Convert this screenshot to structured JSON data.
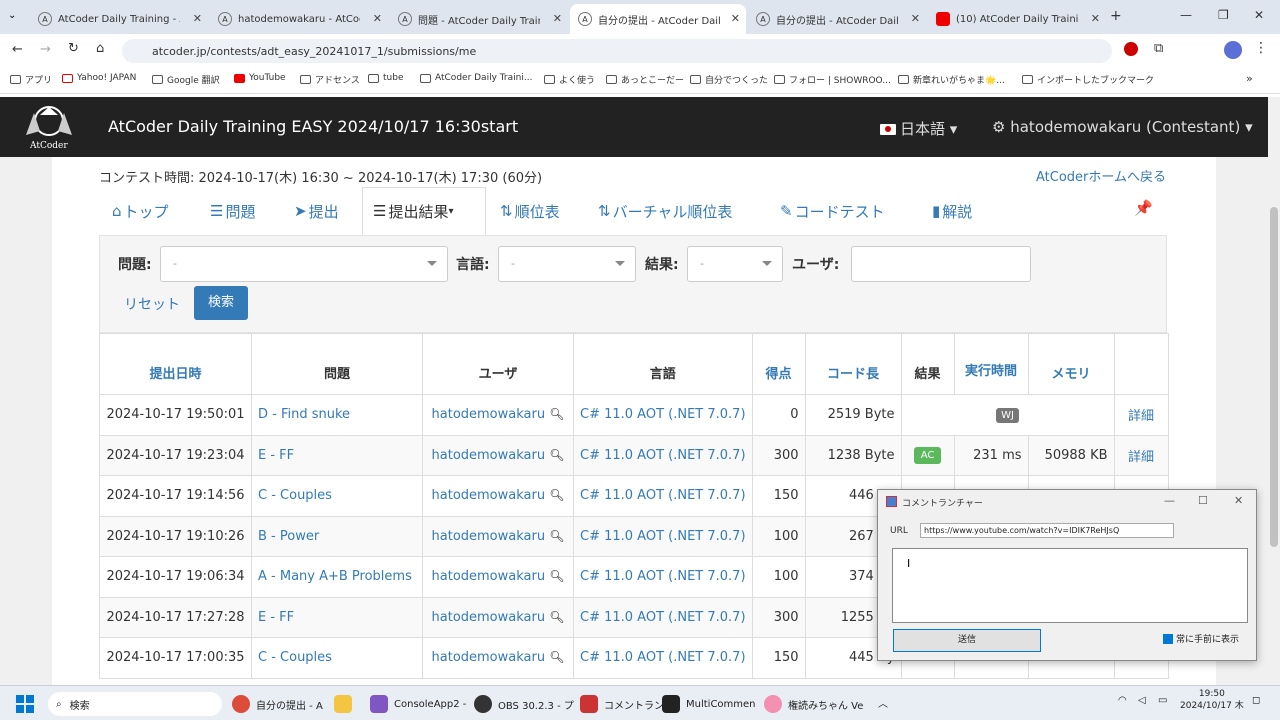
{
  "browser": {
    "tabs": [
      {
        "label": "AtCoder Daily Training - AtCo"
      },
      {
        "label": "hatodemowakaru - AtCoder"
      },
      {
        "label": "問題 - AtCoder Daily Training"
      },
      {
        "label": "自分の提出 - AtCoder Daily T"
      },
      {
        "label": "自分の提出 - AtCoder Daily T"
      },
      {
        "label": "(10) AtCoder Daily Training E"
      }
    ],
    "url": "atcoder.jp/contests/adt_easy_20241017_1/submissions/me",
    "bookmarks": [
      "アプリ",
      "Yahoo! JAPAN",
      "Google 翻訳",
      "YouTube",
      "アドセンス",
      "tube",
      "AtCoder Daily Traini...",
      "よく使う",
      "あっとこーだー",
      "自分でつくった",
      "フォロー | SHOWROO...",
      "新章れいがちゃま🌟...",
      "インポートしたブックマーク"
    ]
  },
  "header": {
    "logo_text": "AtCoder",
    "title": "AtCoder Daily Training EASY 2024/10/17 16:30start",
    "lang": "日本語",
    "user": "hatodemowakaru (Contestant)"
  },
  "contest": {
    "time": "コンテスト時間: 2024-10-17(木) 16:30 ~ 2024-10-17(木) 17:30 (60分)",
    "home_link": "AtCoderホームへ戻る"
  },
  "nav": [
    "トップ",
    "問題",
    "提出",
    "提出結果",
    "順位表",
    "バーチャル順位表",
    "コードテスト",
    "解説"
  ],
  "filter": {
    "problem_label": "問題:",
    "lang_label": "言語:",
    "result_label": "結果:",
    "user_label": "ユーザ:",
    "select_value": "-",
    "reset": "リセット",
    "search": "検索"
  },
  "table": {
    "headers": [
      "提出日時",
      "問題",
      "ユーザ",
      "言語",
      "得点",
      "コード長",
      "結果",
      "実行時間",
      "メモリ",
      ""
    ],
    "rows": [
      {
        "date": "2024-10-17 19:50:01",
        "problem": "D - Find snuke",
        "user": "hatodemowakaru",
        "lang": "C# 11.0 AOT (.NET 7.0.7)",
        "score": "0",
        "len": "2519 Byte",
        "result": "WJ",
        "time": "",
        "mem": "",
        "detail": "詳細"
      },
      {
        "date": "2024-10-17 19:23:04",
        "problem": "E - FF",
        "user": "hatodemowakaru",
        "lang": "C# 11.0 AOT (.NET 7.0.7)",
        "score": "300",
        "len": "1238 Byte",
        "result": "AC",
        "time": "231 ms",
        "mem": "50988 KB",
        "detail": "詳細"
      },
      {
        "date": "2024-10-17 19:14:56",
        "problem": "C - Couples",
        "user": "hatodemowakaru",
        "lang": "C# 11.0 AOT (.NET 7.0.7)",
        "score": "150",
        "len": "446 By",
        "result": "",
        "time": "",
        "mem": "",
        "detail": ""
      },
      {
        "date": "2024-10-17 19:10:26",
        "problem": "B - Power",
        "user": "hatodemowakaru",
        "lang": "C# 11.0 AOT (.NET 7.0.7)",
        "score": "100",
        "len": "267 By",
        "result": "",
        "time": "",
        "mem": "",
        "detail": ""
      },
      {
        "date": "2024-10-17 19:06:34",
        "problem": "A - Many A+B Problems",
        "user": "hatodemowakaru",
        "lang": "C# 11.0 AOT (.NET 7.0.7)",
        "score": "100",
        "len": "374 By",
        "result": "",
        "time": "",
        "mem": "",
        "detail": ""
      },
      {
        "date": "2024-10-17 17:27:28",
        "problem": "E - FF",
        "user": "hatodemowakaru",
        "lang": "C# 11.0 AOT (.NET 7.0.7)",
        "score": "300",
        "len": "1255 By",
        "result": "",
        "time": "",
        "mem": "",
        "detail": ""
      },
      {
        "date": "2024-10-17 17:00:35",
        "problem": "C - Couples",
        "user": "hatodemowakaru",
        "lang": "C# 11.0 AOT (.NET 7.0.7)",
        "score": "150",
        "len": "445 By",
        "result": "",
        "time": "",
        "mem": "",
        "detail": ""
      }
    ]
  },
  "popup": {
    "title": "コメントランチャー",
    "url_label": "URL",
    "url": "https://www.youtube.com/watch?v=IDIK7ReHJsQ",
    "send": "送信",
    "always_on_top": "常に手前に表示"
  },
  "taskbar": {
    "search": "検索",
    "items": [
      "自分の提出 - A",
      "ConsoleApp2 -",
      "OBS 30.2.3 - プ",
      "コメントラン",
      "MultiCommen",
      "権読みちゃん Ve"
    ],
    "time": "19:50",
    "date": "2024/10/17 木"
  }
}
